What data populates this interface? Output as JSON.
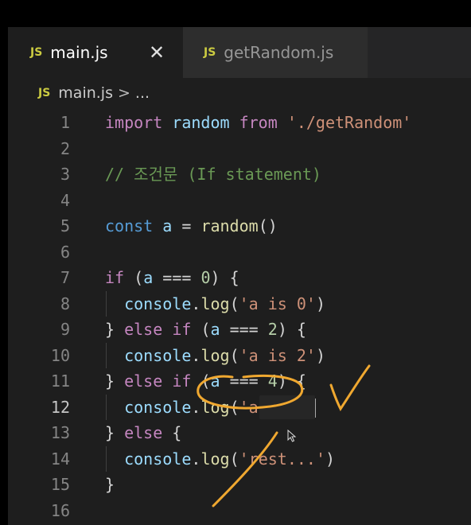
{
  "tabs": [
    {
      "badge": "JS",
      "label": "main.js",
      "close": "✕"
    },
    {
      "badge": "JS",
      "label": "getRandom.js"
    }
  ],
  "breadcrumb": {
    "badge": "JS",
    "file": "main.js",
    "separator": ">",
    "rest": "..."
  },
  "lines": [
    {
      "n": "1",
      "t": [
        [
          "kw2",
          "import"
        ],
        [
          "plain",
          " "
        ],
        [
          "var",
          "random"
        ],
        [
          "plain",
          " "
        ],
        [
          "kw2",
          "from"
        ],
        [
          "plain",
          " "
        ],
        [
          "str",
          "'./getRandom'"
        ]
      ]
    },
    {
      "n": "2",
      "t": []
    },
    {
      "n": "3",
      "t": [
        [
          "cmt",
          "// 조건문 (If statement)"
        ]
      ]
    },
    {
      "n": "4",
      "t": []
    },
    {
      "n": "5",
      "t": [
        [
          "kw",
          "const"
        ],
        [
          "plain",
          " "
        ],
        [
          "var",
          "a"
        ],
        [
          "plain",
          " = "
        ],
        [
          "fn",
          "random"
        ],
        [
          "plain",
          "()"
        ]
      ]
    },
    {
      "n": "6",
      "t": []
    },
    {
      "n": "7",
      "t": [
        [
          "kw2",
          "if"
        ],
        [
          "plain",
          " ("
        ],
        [
          "var",
          "a"
        ],
        [
          "plain",
          " === "
        ],
        [
          "num",
          "0"
        ],
        [
          "plain",
          ") {"
        ]
      ]
    },
    {
      "n": "8",
      "t": [
        [
          "plain",
          "  "
        ],
        [
          "var",
          "console"
        ],
        [
          "plain",
          "."
        ],
        [
          "fn",
          "log"
        ],
        [
          "plain",
          "("
        ],
        [
          "str",
          "'a is 0'"
        ],
        [
          "plain",
          ")"
        ]
      ],
      "guide": true
    },
    {
      "n": "9",
      "t": [
        [
          "plain",
          "} "
        ],
        [
          "kw2",
          "else"
        ],
        [
          "plain",
          " "
        ],
        [
          "kw2",
          "if"
        ],
        [
          "plain",
          " ("
        ],
        [
          "var",
          "a"
        ],
        [
          "plain",
          " === "
        ],
        [
          "num",
          "2"
        ],
        [
          "plain",
          ") {"
        ]
      ]
    },
    {
      "n": "10",
      "t": [
        [
          "plain",
          "  "
        ],
        [
          "var",
          "console"
        ],
        [
          "plain",
          "."
        ],
        [
          "fn",
          "log"
        ],
        [
          "plain",
          "("
        ],
        [
          "str",
          "'a is 2'"
        ],
        [
          "plain",
          ")"
        ]
      ],
      "guide": true
    },
    {
      "n": "11",
      "t": [
        [
          "plain",
          "} "
        ],
        [
          "kw2",
          "else"
        ],
        [
          "plain",
          " "
        ],
        [
          "kw2",
          "if"
        ],
        [
          "plain",
          " ("
        ],
        [
          "var",
          "a"
        ],
        [
          "plain",
          " === "
        ],
        [
          "num",
          "4"
        ],
        [
          "plain",
          ") {"
        ]
      ]
    },
    {
      "n": "12",
      "t": [
        [
          "plain",
          "  "
        ],
        [
          "var",
          "console"
        ],
        [
          "plain",
          "."
        ],
        [
          "fn",
          "log"
        ],
        [
          "plain",
          "("
        ],
        [
          "str",
          "'a is 4"
        ]
      ],
      "guide": true,
      "current": true,
      "cursor": true
    },
    {
      "n": "13",
      "t": [
        [
          "plain",
          "} "
        ],
        [
          "kw2",
          "else"
        ],
        [
          "plain",
          " {"
        ]
      ]
    },
    {
      "n": "14",
      "t": [
        [
          "plain",
          "  "
        ],
        [
          "var",
          "console"
        ],
        [
          "plain",
          "."
        ],
        [
          "fn",
          "log"
        ],
        [
          "plain",
          "("
        ],
        [
          "str",
          "'rest...'"
        ],
        [
          "plain",
          ")"
        ]
      ],
      "guide": true
    },
    {
      "n": "15",
      "t": [
        [
          "plain",
          "}"
        ]
      ]
    },
    {
      "n": "16",
      "t": []
    }
  ],
  "colors": {
    "background": "#1e1e1e",
    "tabbar": "#252526",
    "js_badge": "#cbcb41",
    "annotation": "#f0a830"
  },
  "icons": [
    "js-file-icon",
    "close-icon",
    "mouse-pointer-icon"
  ]
}
